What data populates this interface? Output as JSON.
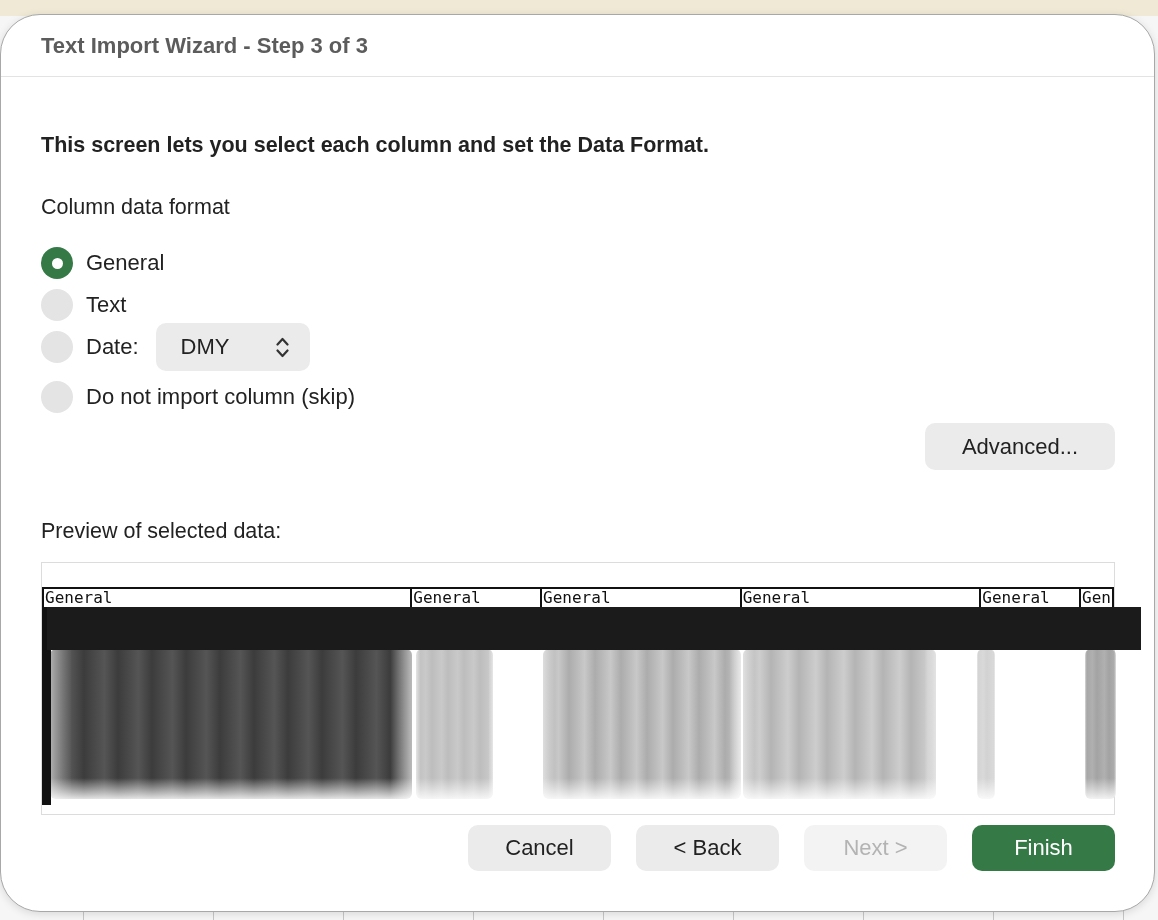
{
  "window": {
    "title": "Text Import Wizard - Step 3 of 3"
  },
  "instruction": "This screen lets you select each column and set the Data Format.",
  "column_data_format": {
    "label": "Column data format",
    "options": [
      {
        "kind": "plain",
        "label": "General",
        "selected": true
      },
      {
        "kind": "plain",
        "label": "Text",
        "selected": false
      },
      {
        "kind": "date",
        "label": "Date:",
        "selected": false,
        "select": {
          "value": "DMY"
        }
      },
      {
        "kind": "plain",
        "label": "Do not import column (skip)",
        "selected": false
      }
    ]
  },
  "advanced_button": {
    "label": "Advanced..."
  },
  "preview": {
    "label": "Preview of selected data:",
    "columns": [
      {
        "header": "General"
      },
      {
        "header": "General"
      },
      {
        "header": "General"
      },
      {
        "header": "General"
      },
      {
        "header": "General"
      },
      {
        "header": "Gen"
      }
    ]
  },
  "buttons": [
    {
      "kind": "secondary",
      "label": "Cancel",
      "disabled": false
    },
    {
      "kind": "secondary",
      "label": "< Back",
      "disabled": false
    },
    {
      "kind": "secondary",
      "label": "Next >",
      "disabled": true
    },
    {
      "kind": "primary",
      "label": "Finish",
      "disabled": false
    }
  ]
}
